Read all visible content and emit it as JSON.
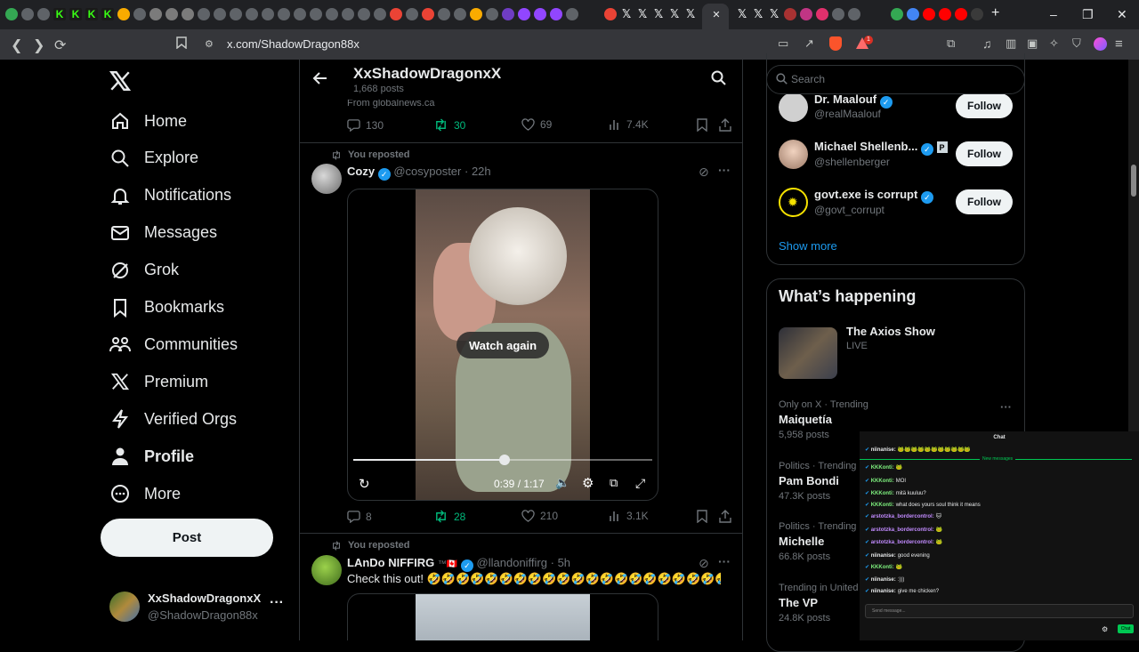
{
  "browser": {
    "url": "x.com/ShadowDragon88x",
    "active_tab_close": "✕",
    "new_tab": "+",
    "notif_badge": "1"
  },
  "nav": {
    "items": [
      {
        "label": "Home",
        "icon": "home-icon"
      },
      {
        "label": "Explore",
        "icon": "search-icon"
      },
      {
        "label": "Notifications",
        "icon": "bell-icon"
      },
      {
        "label": "Messages",
        "icon": "mail-icon"
      },
      {
        "label": "Grok",
        "icon": "grok-icon"
      },
      {
        "label": "Bookmarks",
        "icon": "bookmark-icon"
      },
      {
        "label": "Communities",
        "icon": "communities-icon"
      },
      {
        "label": "Premium",
        "icon": "x-logo-icon"
      },
      {
        "label": "Verified Orgs",
        "icon": "lightning-icon"
      },
      {
        "label": "Profile",
        "icon": "person-icon"
      },
      {
        "label": "More",
        "icon": "more-circle-icon"
      }
    ],
    "post_label": "Post",
    "account": {
      "name": "XxShadowDragonxX",
      "handle": "@ShadowDragon88x"
    }
  },
  "profile_header": {
    "name": "XxShadowDragonxX",
    "posts": "1,668 posts"
  },
  "tweet0": {
    "source": "From globalnews.ca",
    "replies": "130",
    "reposts": "30",
    "likes": "69",
    "views": "7.4K"
  },
  "tweet1": {
    "reposted": "You reposted",
    "name": "Cozy",
    "handle": "@cosyposter",
    "time": "· 22h",
    "watch_again": "Watch again",
    "time_display": "0:39 / 1:17",
    "progress": 0.506,
    "replies": "8",
    "reposts": "28",
    "likes": "210",
    "views": "3.1K"
  },
  "tweet2": {
    "reposted": "You reposted",
    "name": "LAnDo NIFFIRG",
    "name_suffix": "™🇨🇦",
    "handle": "@llandoniffirg",
    "time": "· 5h",
    "text": "Check this out! 🤣🤣🤣🤣🤣🤣🤣🤣🤣🤣🤣🤣🤣🤣🤣🤣🤣🤣🤣🤣🤣🤣"
  },
  "search": {
    "placeholder": "Search"
  },
  "who_to_follow": {
    "follow_label": "Follow",
    "accounts": [
      {
        "name": "Dr. Maalouf",
        "handle": "@realMaalouf"
      },
      {
        "name": "Michael Shellenb...",
        "handle": "@shellenberger"
      },
      {
        "name": "govt.exe is corrupt",
        "handle": "@govt_corrupt"
      }
    ],
    "show_more": "Show more"
  },
  "happening": {
    "title": "What’s happening",
    "live": {
      "title": "The Axios Show",
      "status": "LIVE"
    },
    "trends": [
      {
        "context": "Only on X · Trending",
        "name": "Maiquetía",
        "posts": "5,958 posts"
      },
      {
        "context": "Politics · Trending",
        "name": "Pam Bondi",
        "posts": "47.3K posts"
      },
      {
        "context": "Politics · Trending",
        "name": "Michelle",
        "posts": "66.8K posts"
      },
      {
        "context": "Trending in United",
        "name": "The VP",
        "posts": "24.8K posts"
      }
    ]
  },
  "chat": {
    "title": "Chat",
    "new_messages": "New messages",
    "messages": [
      {
        "user": "niinanise:",
        "text": "🐸🐸🐸🐸🐸🐸🐸🐸🐸🐸🐸"
      },
      {
        "user": "KKKonti:",
        "text": "🐸"
      },
      {
        "user": "KKKonti:",
        "text": "MOI"
      },
      {
        "user": "KKKonti:",
        "text": "mitä kuuluu?"
      },
      {
        "user": "KKKonti:",
        "text": "what does yours soul think it means"
      },
      {
        "user": "arstotzka_bordercontrol:",
        "text": "🐱"
      },
      {
        "user": "arstotzka_bordercontrol:",
        "text": "🐸"
      },
      {
        "user": "arstotzka_bordercontrol:",
        "text": "🐸"
      },
      {
        "user": "niinanise:",
        "text": "good evening"
      },
      {
        "user": "KKKonti:",
        "text": "🐸"
      },
      {
        "user": "niinanise:",
        "text": ":)))"
      },
      {
        "user": "niinanise:",
        "text": "give me chicken?"
      }
    ],
    "input_placeholder": "Send message...",
    "send_label": "Chat"
  },
  "colors": {
    "accent": "#1d9bf0",
    "repost_green": "#00ba7c",
    "background": "#000000"
  }
}
